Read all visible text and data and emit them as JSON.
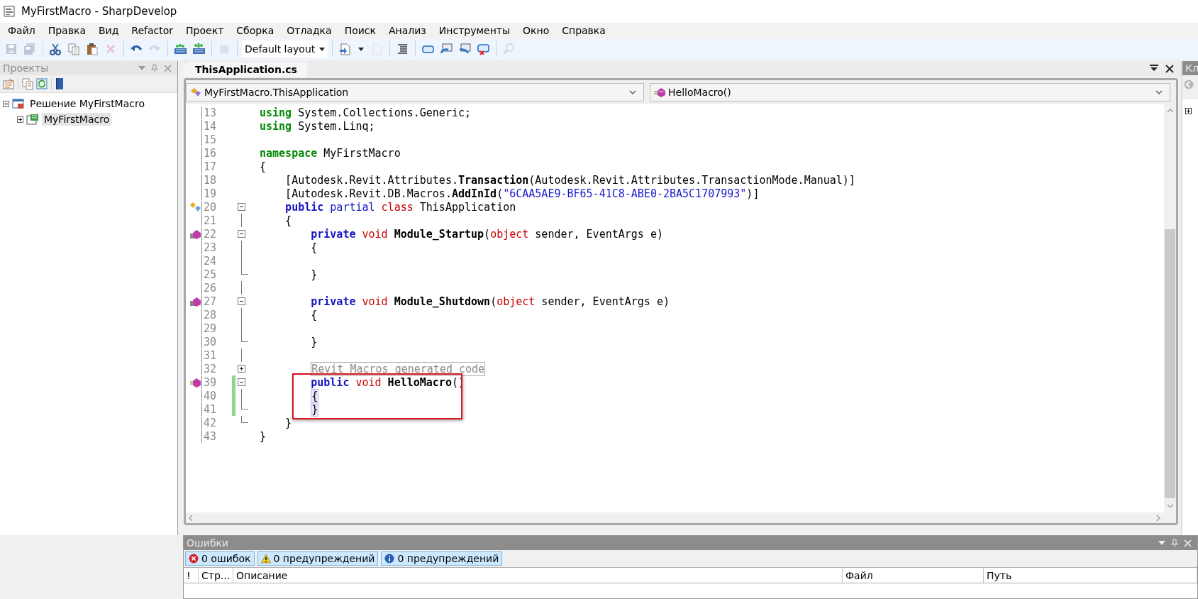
{
  "window": {
    "title": "MyFirstMacro - SharpDevelop"
  },
  "menu": [
    "Файл",
    "Правка",
    "Вид",
    "Refactor",
    "Проект",
    "Сборка",
    "Отладка",
    "Поиск",
    "Анализ",
    "Инструменты",
    "Окно",
    "Справка"
  ],
  "toolbar": [
    {
      "kind": "button",
      "disabled": true
    },
    {
      "kind": "button",
      "disabled": true
    },
    {
      "kind": "separator"
    },
    {
      "kind": "button",
      "disabled": false
    },
    {
      "kind": "button",
      "disabled": false
    },
    {
      "kind": "button",
      "disabled": false
    },
    {
      "kind": "button",
      "disabled": true
    },
    {
      "kind": "separator"
    },
    {
      "kind": "button",
      "disabled": false
    },
    {
      "kind": "button",
      "disabled": true
    },
    {
      "kind": "separator"
    },
    {
      "kind": "button",
      "disabled": false
    },
    {
      "kind": "button",
      "disabled": false
    },
    {
      "kind": "separator"
    },
    {
      "kind": "button",
      "disabled": true
    },
    {
      "kind": "separator"
    },
    {
      "kind": "dropdown",
      "value": "Default layout"
    },
    {
      "kind": "separator"
    },
    {
      "kind": "button",
      "disabled": false
    },
    {
      "kind": "button",
      "disabled": true
    },
    {
      "kind": "separator"
    },
    {
      "kind": "button",
      "disabled": false
    },
    {
      "kind": "separator"
    },
    {
      "kind": "button",
      "disabled": false
    },
    {
      "kind": "button",
      "disabled": false
    },
    {
      "kind": "button",
      "disabled": false
    },
    {
      "kind": "button",
      "disabled": false
    },
    {
      "kind": "separator"
    },
    {
      "kind": "button",
      "disabled": true
    }
  ],
  "projects_panel": {
    "title": "Проекты",
    "tree": [
      {
        "label": "Решение MyFirstMacro",
        "expanded": true,
        "selected": false,
        "children": [
          {
            "label": "MyFirstMacro",
            "expanded": false,
            "selected": true
          }
        ]
      }
    ]
  },
  "editor": {
    "tabs": [
      {
        "label": "ThisApplication.cs",
        "selected": true
      }
    ],
    "class_dropdown": "MyFirstMacro.ThisApplication",
    "member_dropdown": "HelloMacro()",
    "lines": [
      {
        "number": "13",
        "tokens": [
          {
            "kind": "keyword",
            "text": "using"
          },
          {
            "kind": "plain",
            "text": " System.Collections.Generic;"
          }
        ]
      },
      {
        "number": "14",
        "tokens": [
          {
            "kind": "keyword",
            "text": "using"
          },
          {
            "kind": "plain",
            "text": " System.Linq;"
          }
        ]
      },
      {
        "number": "15"
      },
      {
        "number": "16",
        "tokens": [
          {
            "kind": "keyword",
            "text": "namespace"
          },
          {
            "kind": "plain",
            "text": " MyFirstMacro"
          }
        ]
      },
      {
        "number": "17",
        "tokens": [
          {
            "kind": "plain",
            "text": "{"
          }
        ]
      },
      {
        "number": "18",
        "tokens": [
          {
            "kind": "plain",
            "text": "    [Autodesk.Revit.Attributes."
          },
          {
            "kind": "member",
            "text": "Transaction"
          },
          {
            "kind": "plain",
            "text": "(Autodesk.Revit.Attributes.TransactionMode.Manual)]"
          }
        ]
      },
      {
        "number": "19",
        "tokens": [
          {
            "kind": "plain",
            "text": "    [Autodesk.Revit.DB.Macros."
          },
          {
            "kind": "member",
            "text": "AddInId"
          },
          {
            "kind": "plain",
            "text": "("
          },
          {
            "kind": "string",
            "text": "\"6CAA5AE9-BF65-41C8-ABE0-2BA5C1707993\""
          },
          {
            "kind": "plain",
            "text": ")]"
          }
        ]
      },
      {
        "number": "20",
        "kind": "class",
        "foldable": true,
        "expanded": true,
        "tokens": [
          {
            "kind": "modifier",
            "text": "    public"
          },
          {
            "kind": "modifier-light",
            "text": " partial"
          },
          {
            "kind": "type",
            "text": " class"
          },
          {
            "kind": "plain",
            "text": " ThisApplication"
          }
        ]
      },
      {
        "number": "21",
        "fold_line": true,
        "tokens": [
          {
            "kind": "plain",
            "text": "    {"
          }
        ]
      },
      {
        "number": "22",
        "kind": "event",
        "foldable": true,
        "expanded": true,
        "tokens": [
          {
            "kind": "modifier",
            "text": "        private"
          },
          {
            "kind": "type",
            "text": " void"
          },
          {
            "kind": "member",
            "text": " Module_Startup"
          },
          {
            "kind": "plain",
            "text": "("
          },
          {
            "kind": "type",
            "text": "object"
          },
          {
            "kind": "plain",
            "text": " sender, EventArgs e)"
          }
        ]
      },
      {
        "number": "23",
        "fold_line": true,
        "tokens": [
          {
            "kind": "plain",
            "text": "        {"
          }
        ]
      },
      {
        "number": "24",
        "fold_line": true
      },
      {
        "number": "25",
        "fold_end": true,
        "tokens": [
          {
            "kind": "plain",
            "text": "        }"
          }
        ]
      },
      {
        "number": "26",
        "fold_line": true
      },
      {
        "number": "27",
        "kind": "event",
        "foldable": true,
        "expanded": true,
        "tokens": [
          {
            "kind": "modifier",
            "text": "        private"
          },
          {
            "kind": "type",
            "text": " void"
          },
          {
            "kind": "member",
            "text": " Module_Shutdown"
          },
          {
            "kind": "plain",
            "text": "("
          },
          {
            "kind": "type",
            "text": "object"
          },
          {
            "kind": "plain",
            "text": " sender, EventArgs e)"
          }
        ]
      },
      {
        "number": "28",
        "fold_line": true,
        "tokens": [
          {
            "kind": "plain",
            "text": "        {"
          }
        ]
      },
      {
        "number": "29",
        "fold_line": true
      },
      {
        "number": "30",
        "fold_end": true,
        "tokens": [
          {
            "kind": "plain",
            "text": "        }"
          }
        ]
      },
      {
        "number": "31",
        "fold_line": true
      },
      {
        "number": "32",
        "foldable": true,
        "expanded": false,
        "tokens": [
          {
            "kind": "collapsed",
            "text": "        Revit Macros generated code"
          }
        ]
      },
      {
        "number": "39",
        "kind": "method",
        "foldable": true,
        "expanded": true,
        "changed": true,
        "boxed": true,
        "tokens": [
          {
            "kind": "modifier",
            "text": "        public"
          },
          {
            "kind": "type",
            "text": " void"
          },
          {
            "kind": "member",
            "text": " HelloMacro"
          },
          {
            "kind": "plain",
            "text": "()"
          }
        ]
      },
      {
        "number": "40",
        "fold_line": true,
        "changed": true,
        "boxed": true,
        "tokens": [
          {
            "kind": "brace",
            "text": "        {"
          }
        ]
      },
      {
        "number": "41",
        "fold_end": true,
        "changed": true,
        "boxed": true,
        "tokens": [
          {
            "kind": "brace",
            "text": "        }"
          }
        ]
      },
      {
        "number": "42",
        "fold_end": true,
        "tokens": [
          {
            "kind": "plain",
            "text": "    }"
          }
        ]
      },
      {
        "number": "43",
        "tokens": [
          {
            "kind": "plain",
            "text": "}"
          }
        ]
      }
    ]
  },
  "errors_panel": {
    "title": "Ошибки",
    "filters": [
      {
        "kind": "error",
        "label": "0 ошибок",
        "selected": true
      },
      {
        "kind": "warning",
        "label": "0 предупреждений",
        "selected": true
      },
      {
        "kind": "info",
        "label": "0 предупреждений",
        "selected": true
      }
    ],
    "columns": [
      "!",
      "Стр...",
      "Описание",
      "Файл",
      "Путь"
    ]
  },
  "side_panel": {
    "title": "Кл"
  }
}
